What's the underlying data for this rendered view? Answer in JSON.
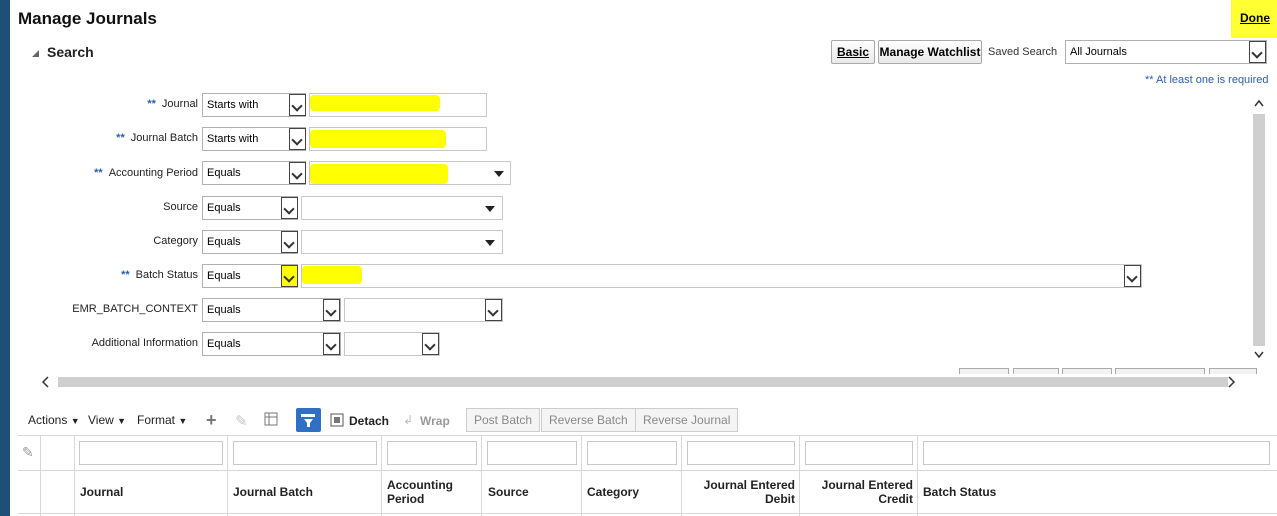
{
  "page": {
    "title": "Manage Journals",
    "done_label": "Done"
  },
  "search": {
    "title": "Search",
    "basic_label": "Basic",
    "manage_watchlist_label": "Manage Watchlist",
    "saved_search_label": "Saved Search",
    "saved_search_value": "All Journals",
    "required_hint": "** At least one is required",
    "required_marker": "**",
    "fields": [
      {
        "label": "Journal",
        "operator": "Starts with",
        "required": true
      },
      {
        "label": "Journal Batch",
        "operator": "Starts with",
        "required": true
      },
      {
        "label": "Accounting Period",
        "operator": "Equals",
        "required": true
      },
      {
        "label": "Source",
        "operator": "Equals",
        "required": false
      },
      {
        "label": "Category",
        "operator": "Equals",
        "required": false
      },
      {
        "label": "Batch Status",
        "operator": "Equals",
        "required": true
      },
      {
        "label": "EMR_BATCH_CONTEXT",
        "operator": "Equals",
        "required": false
      },
      {
        "label": "Additional Information",
        "operator": "Equals",
        "required": false
      }
    ]
  },
  "toolbar": {
    "actions_label": "Actions",
    "view_label": "View",
    "format_label": "Format",
    "detach_label": "Detach",
    "wrap_label": "Wrap",
    "post_batch_label": "Post Batch",
    "reverse_batch_label": "Reverse Batch",
    "reverse_journal_label": "Reverse Journal"
  },
  "table": {
    "columns": [
      {
        "line1": "Journal",
        "line2": ""
      },
      {
        "line1": "Journal Batch",
        "line2": ""
      },
      {
        "line1": "Accounting",
        "line2": "Period"
      },
      {
        "line1": "Source",
        "line2": ""
      },
      {
        "line1": "Category",
        "line2": ""
      },
      {
        "line1": "Journal Entered",
        "line2": "Debit"
      },
      {
        "line1": "Journal Entered",
        "line2": "Credit"
      },
      {
        "line1": "Batch Status",
        "line2": ""
      }
    ]
  },
  "colors": {
    "left_bar": "#1f4e79",
    "highlight": "#ffff00",
    "required_marker": "#2d5fa8",
    "detach_icon": "#2f6fc4"
  }
}
